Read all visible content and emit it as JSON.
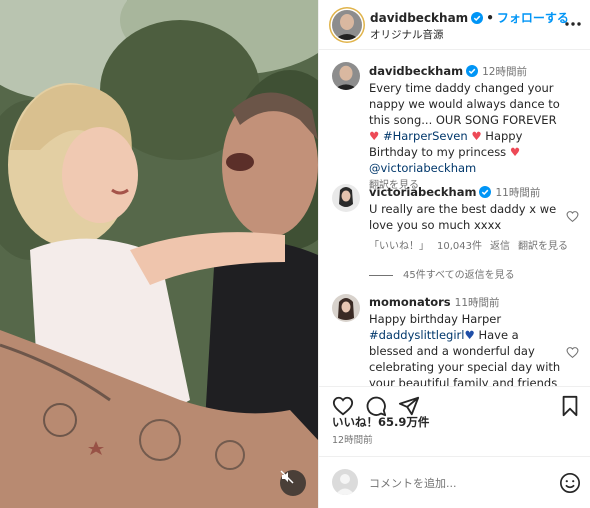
{
  "post": {
    "author": "davidbeckham",
    "follow_label": "フォローする",
    "audio_label": "オリジナル音源"
  },
  "caption": {
    "user": "davidbeckham",
    "time": "12時間前",
    "text_part1": "Every time daddy changed your nappy we would always dance to this song... OUR SONG FOREVER ",
    "hashtag": "#HarperSeven",
    "text_part2": " Happy Birthday to my princess ",
    "mention": "@victoriabeckham",
    "translate": "翻訳を見る"
  },
  "comments": [
    {
      "user": "victoriabeckham",
      "time": "11時間前",
      "text": "U really are the best daddy x we love you so much xxxx",
      "like_btn": "「いいね！」",
      "like_count": "10,043件",
      "reply": "返信",
      "translate": "翻訳を見る",
      "view_replies": "45件すべての返信を見る"
    },
    {
      "user": "momonators",
      "time": "11時間前",
      "text_part1": "Happy birthday Harper ",
      "hashtag": "#daddyslittlegirl",
      "text_part2": " Have a blessed and a wonderful day celebrating your special day with your beautiful family and friends"
    }
  ],
  "footer": {
    "likes": "いいね！65.9万件",
    "time": "12時間前",
    "comment_placeholder": "コメントを追加..."
  },
  "colors": {
    "accent": "#0095f6",
    "link": "#00376b",
    "heart": "#ed4956",
    "muted": "#737373"
  },
  "icons": [
    "verified-icon",
    "more-icon",
    "heart-icon",
    "comment-icon",
    "share-icon",
    "bookmark-icon",
    "emoji-icon",
    "mute-icon"
  ]
}
